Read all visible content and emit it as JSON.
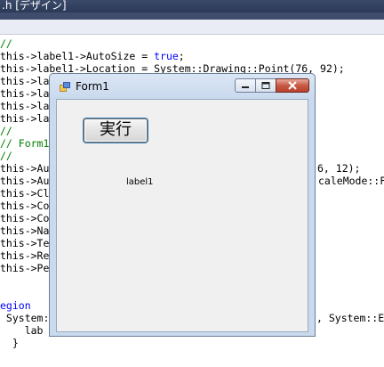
{
  "ide": {
    "title": ".h [デザイン]"
  },
  "code_lines": [
    "//",
    "this->label1->AutoSize = true;",
    "this->label1->Location = System::Drawing::Point(76, 92);",
    "this->la",
    "this->la",
    "this->la",
    "this->la",
    "//",
    "// Form1",
    "//",
    "this->Au",
    "this->Au",
    "this->Cl",
    "this->Co",
    "this->Co",
    "this->Na",
    "this->Te",
    "this->Re",
    "this->Pe"
  ],
  "code_right": {
    "line_autoscale_dims": "6, 12);",
    "line_autoscale_mode": "caleMode::F",
    "line_system_e": ", System::E"
  },
  "code_bottom": {
    "region": "egion",
    "system": " System:",
    "lab": "    lab",
    "brace": "  }"
  },
  "form": {
    "title": "Form1",
    "button_label": "実行",
    "label_text": "label1"
  }
}
